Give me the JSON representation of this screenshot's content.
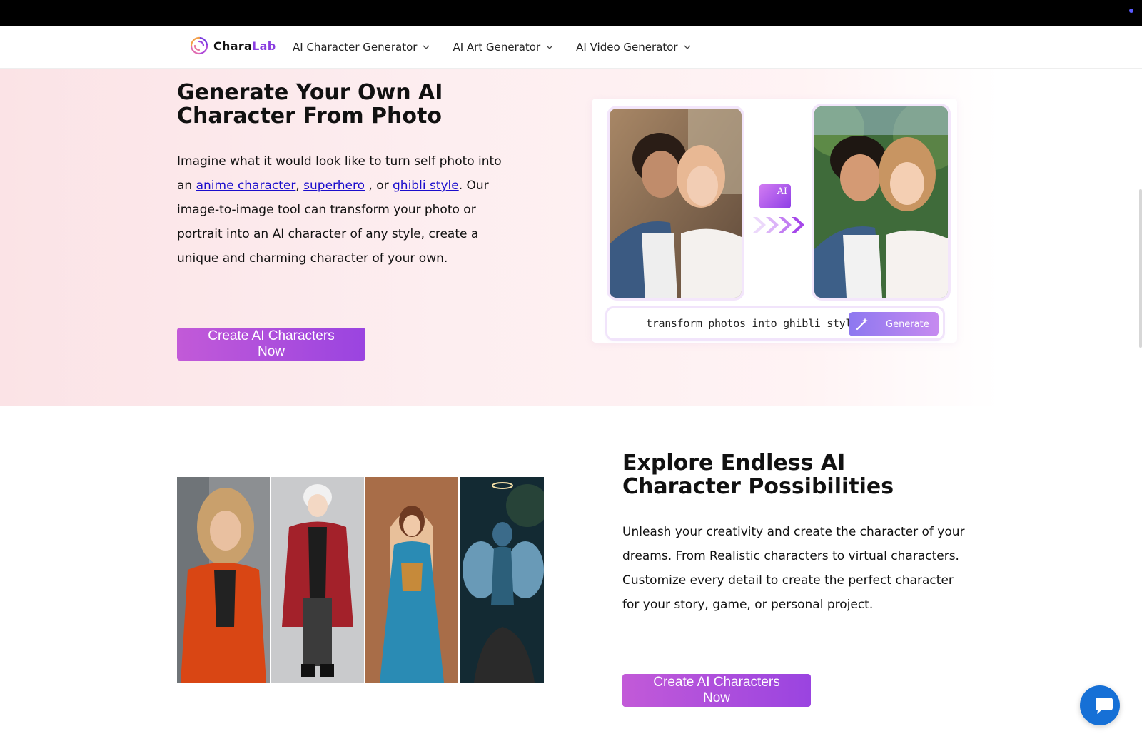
{
  "brand": {
    "name_part1": "Chara",
    "name_part2": "Lab",
    "accent_color": "#8a3ee0",
    "icon": "charalab-swirl-logo"
  },
  "nav": {
    "items": [
      {
        "label": "AI Character Generator",
        "icon": "chevron-down-icon"
      },
      {
        "label": "AI Art Generator",
        "icon": "chevron-down-icon"
      },
      {
        "label": "AI Video Generator",
        "icon": "chevron-down-icon"
      }
    ]
  },
  "hero": {
    "title": "Generate Your Own AI Character From Photo",
    "para_before": "Imagine what it would look like to turn self photo into an ",
    "link1": "anime character",
    "sep1": ", ",
    "link2": "superhero",
    "sep2": " , or ",
    "link3": "ghibli style",
    "para_after": ". Our image-to-image tool can transform your photo or portrait into an AI character of any style, create a unique and charming character of your own.",
    "cta": "Create AI Characters Now",
    "demo": {
      "badge": "AI",
      "prompt": "transform photos into ghibli style",
      "generate": "Generate"
    }
  },
  "explore": {
    "title": "Explore Endless AI Character Possibilities",
    "para": "Unleash your creativity and create the character of your dreams. From Realistic characters to virtual characters. Customize every detail to create the perfect character for your story, game, or personal project.",
    "cta": "Create AI Characters Now"
  },
  "colors": {
    "cta_gradient_start": "#c25ad8",
    "cta_gradient_end": "#9a44e0",
    "link": "#1a0dcc",
    "chat": "#1670d6"
  }
}
